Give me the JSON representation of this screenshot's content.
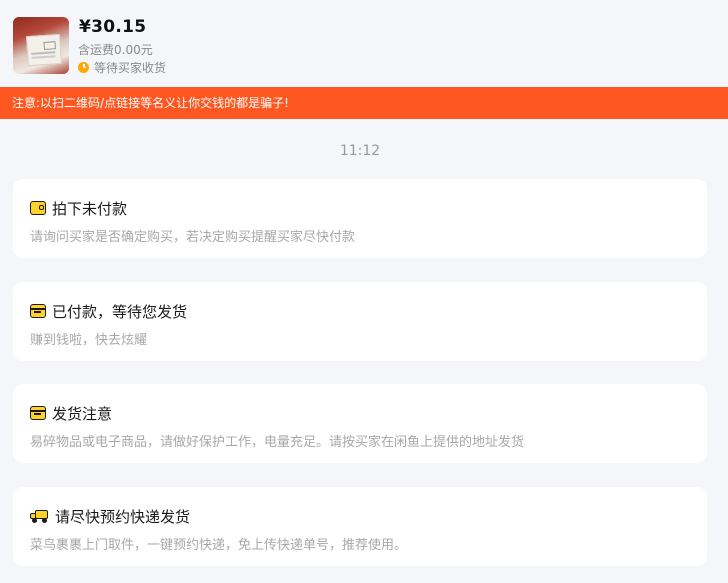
{
  "order": {
    "price": "¥30.15",
    "shipping": "含运费0.00元",
    "status": "等待买家收货",
    "status_color": "#ffa800"
  },
  "warning": {
    "text": "注意:以扫二维码/点链接等名义让你交钱的都是骗子!",
    "color": "#ff5722"
  },
  "timestamp": "11:12",
  "cards": [
    {
      "icon": "wallet-icon",
      "title": "拍下未付款",
      "desc": "请询问买家是否确定购买，若决定购买提醒买家尽快付款"
    },
    {
      "icon": "package-icon",
      "title": "已付款，等待您发货",
      "desc": "赚到钱啦，快去炫耀"
    },
    {
      "icon": "package-icon",
      "title": "发货注意",
      "desc": "易碎物品或电子商品，请做好保护工作，电量充足。请按买家在闲鱼上提供的地址发货"
    },
    {
      "icon": "truck-icon",
      "title": "请尽快预约快递发货",
      "desc": "菜鸟裹裹上门取件，一键预约快递，免上传快递单号，推荐使用。"
    }
  ],
  "icon_color": "#ffd22a"
}
